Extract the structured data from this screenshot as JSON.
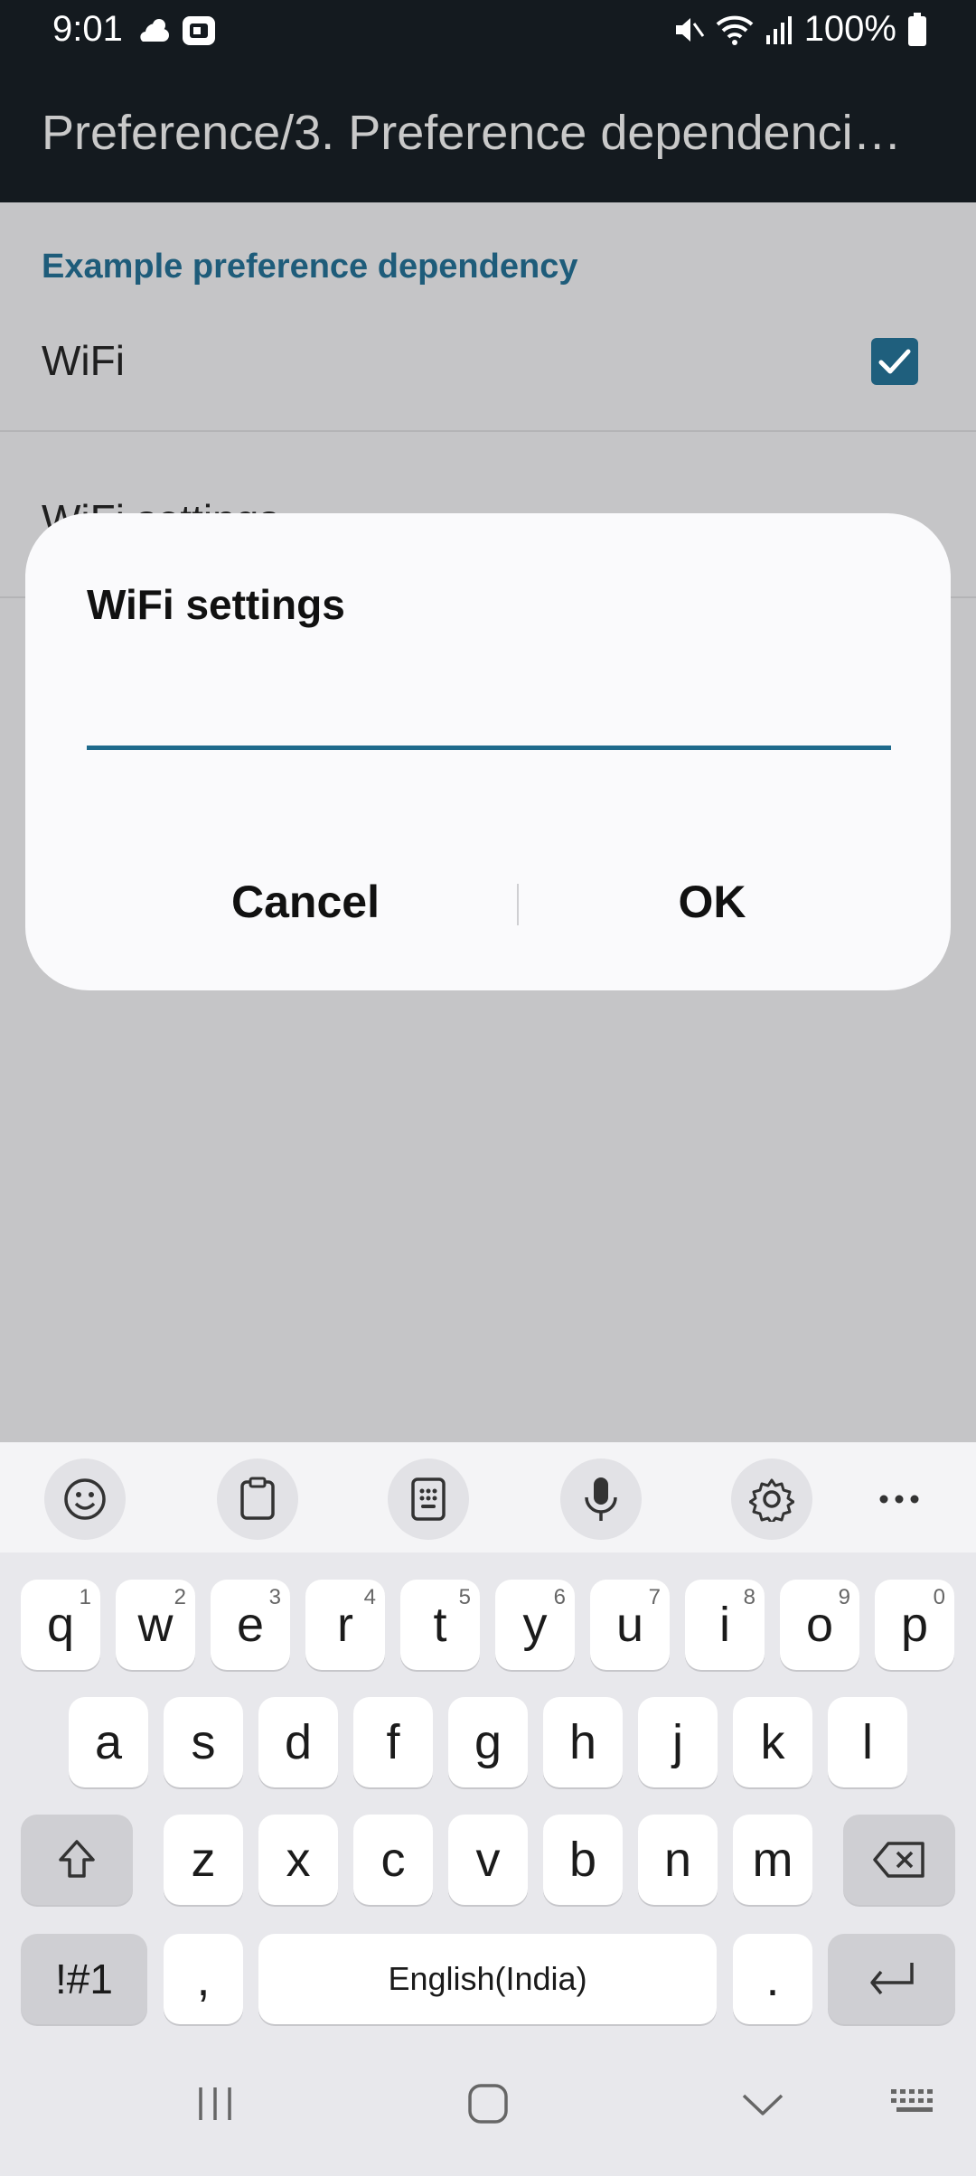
{
  "status_bar": {
    "time": "9:01",
    "battery": "100%",
    "icons_left": [
      "cloud-sun-icon",
      "app-notification-icon"
    ],
    "icons_right": [
      "mute-icon",
      "wifi-icon",
      "signal-icon",
      "battery-icon"
    ]
  },
  "app_bar": {
    "title": "Preference/3. Preference dependenci…"
  },
  "preferences": {
    "category": "Example preference dependency",
    "wifi_label": "WiFi",
    "wifi_checked": true,
    "wifi_settings_label": "WiFi settings"
  },
  "dialog": {
    "title": "WiFi settings",
    "input_value": "",
    "cancel_label": "Cancel",
    "ok_label": "OK"
  },
  "keyboard": {
    "toolbar": [
      "emoji-icon",
      "clipboard-icon",
      "keypad-icon",
      "microphone-icon",
      "settings-icon",
      "more-icon"
    ],
    "row1": [
      {
        "k": "q",
        "h": "1"
      },
      {
        "k": "w",
        "h": "2"
      },
      {
        "k": "e",
        "h": "3"
      },
      {
        "k": "r",
        "h": "4"
      },
      {
        "k": "t",
        "h": "5"
      },
      {
        "k": "y",
        "h": "6"
      },
      {
        "k": "u",
        "h": "7"
      },
      {
        "k": "i",
        "h": "8"
      },
      {
        "k": "o",
        "h": "9"
      },
      {
        "k": "p",
        "h": "0"
      }
    ],
    "row2": [
      "a",
      "s",
      "d",
      "f",
      "g",
      "h",
      "j",
      "k",
      "l"
    ],
    "row3": [
      "z",
      "x",
      "c",
      "v",
      "b",
      "n",
      "m"
    ],
    "symbols_label": "!#1",
    "comma_label": ",",
    "space_label": "English(India)",
    "period_label": "."
  },
  "nav_bar": [
    "recents-icon",
    "home-icon",
    "back-icon",
    "keyboard-switch-icon"
  ]
}
